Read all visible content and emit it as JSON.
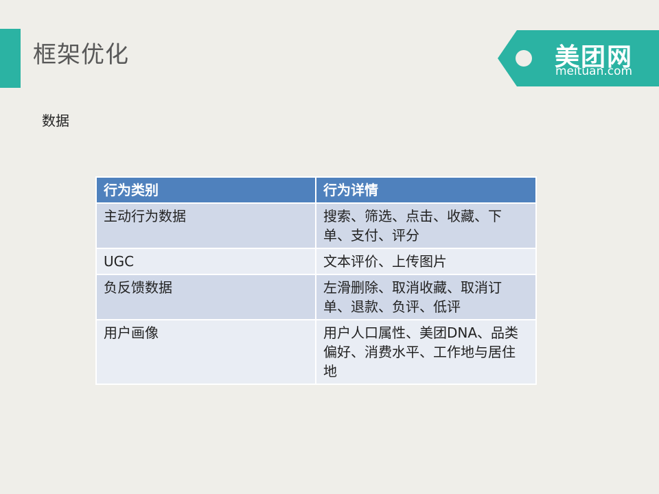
{
  "slide": {
    "title": "框架优化",
    "section_label": "数据"
  },
  "logo": {
    "brand": "美团网",
    "domain": "meituan.com",
    "color": "#2bb3a3"
  },
  "table": {
    "headers": [
      "行为类别",
      "行为详情"
    ],
    "rows": [
      {
        "category": "主动行为数据",
        "detail": "搜索、筛选、点击、收藏、下单、支付、评分"
      },
      {
        "category": "UGC",
        "detail": "文本评价、上传图片"
      },
      {
        "category": "负反馈数据",
        "detail": "左滑删除、取消收藏、取消订单、退款、负评、低评"
      },
      {
        "category": "用户画像",
        "detail": "用户人口属性、美团DNA、品类偏好、消费水平、工作地与居住地"
      }
    ],
    "header_color": "#4f81bd",
    "row_colors": [
      "#d0d8e8",
      "#e9edf4"
    ]
  }
}
